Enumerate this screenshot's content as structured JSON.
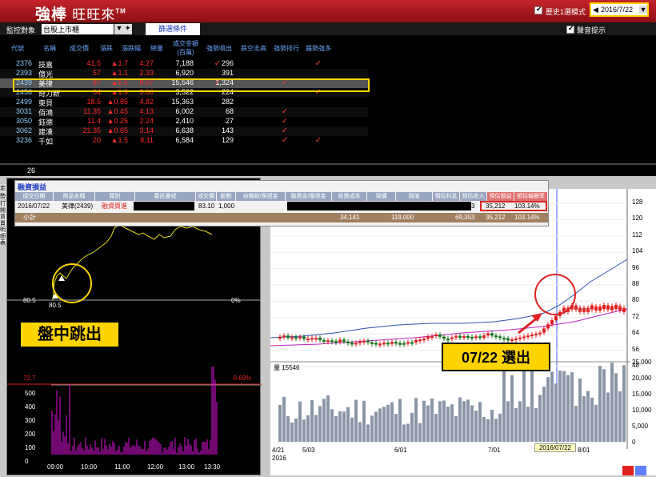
{
  "app": {
    "logo_main": "強棒",
    "logo_sub": "旺旺來",
    "logo_tm": "TM",
    "hist_label": "歷史1選模式",
    "date": "2016/7/22",
    "date_prev": "◀",
    "date_drop": "▼"
  },
  "toolbar": {
    "monitor_label": "監控對象",
    "monitor_value": "台股上市櫃",
    "monitor_btn": "▼ ✦",
    "filter_btn": "篩選條件",
    "sound_label": "聲音提示"
  },
  "table": {
    "headers": [
      "代號",
      "名稱",
      "成交價",
      "漲跌",
      "漲跌幅",
      "總量",
      "成交金額(百萬)",
      "強勢噴出",
      "跌空走高",
      "強勢排行",
      "趨勢強多"
    ],
    "rows": [
      {
        "code": "2376",
        "name": "技嘉",
        "price": "41.5",
        "chg": "▲1.7",
        "pct": "4.27",
        "vol": "7,188",
        "amt": "296",
        "checks": [
          1,
          0,
          0,
          1
        ]
      },
      {
        "code": "2393",
        "name": "億光",
        "price": "57",
        "chg": "▲1.1",
        "pct": "2.33",
        "vol": "6,920",
        "amt": "391",
        "checks": [
          0,
          0,
          0,
          0
        ]
      },
      {
        "code": "2439",
        "name": "美律",
        "price": "87",
        "chg": "▲6.5",
        "pct": "8.07",
        "vol": "15,546",
        "amt": "1,324",
        "checks": [
          1,
          0,
          1,
          0
        ]
      },
      {
        "code": "2456",
        "name": "奇力新",
        "price": "64",
        "chg": "▲1.9",
        "pct": "3.06",
        "vol": "3,522",
        "amt": "224",
        "checks": [
          0,
          0,
          0,
          1
        ]
      },
      {
        "code": "2499",
        "name": "東貝",
        "price": "18.5",
        "chg": "▲0.85",
        "pct": "4.82",
        "vol": "15,363",
        "amt": "282",
        "checks": [
          0,
          0,
          0,
          0
        ]
      },
      {
        "code": "3031",
        "name": "佰鴻",
        "price": "11.35",
        "chg": "▲0.45",
        "pct": "4.13",
        "vol": "6,002",
        "amt": "68",
        "checks": [
          0,
          0,
          1,
          0
        ]
      },
      {
        "code": "3050",
        "name": "鈺德",
        "price": "11.4",
        "chg": "▲0.25",
        "pct": "2.24",
        "vol": "2,410",
        "amt": "27",
        "checks": [
          0,
          0,
          1,
          0
        ]
      },
      {
        "code": "3062",
        "name": "建漢",
        "price": "21.35",
        "chg": "▲0.65",
        "pct": "3.14",
        "vol": "6,638",
        "amt": "143",
        "checks": [
          0,
          0,
          1,
          0
        ]
      },
      {
        "code": "3236",
        "name": "千如",
        "price": "20",
        "chg": "▲1.5",
        "pct": "8.11",
        "vol": "6,584",
        "amt": "129",
        "checks": [
          0,
          0,
          1,
          1
        ]
      }
    ],
    "count": "26"
  },
  "popup": {
    "title": "融資損益",
    "headers": [
      "成交日期",
      "商品名稱",
      "類別",
      "委託書號",
      "成交價",
      "股數",
      "自備款/保證金",
      "融資金/擔保金",
      "投資成本",
      "現價",
      "現值",
      "預估利息",
      "預估收入",
      "預估損益",
      "預估報酬率"
    ],
    "row": {
      "date": "2016/07/22",
      "name": "美律(2439)",
      "type": "融資買進",
      "price": "83.10",
      "shares": "1,000",
      "income": "69,353",
      "pl": "35,212",
      "ret": "103.14%"
    },
    "sub": {
      "label": "小計",
      "cost": "34,141",
      "value": "119,000",
      "income": "69,353",
      "pl": "35,212",
      "ret": "103.14%"
    }
  },
  "intraday": {
    "left_tabs": "走勢",
    "side_text": "打開買賣明細表",
    "ref_price": "80.5",
    "ref_pct": "0%",
    "low_price": "72.7",
    "low_pct": "-9.69%",
    "callout": "盤中跳出",
    "vol_ticks": [
      "500",
      "400",
      "300",
      "200",
      "100",
      "0"
    ],
    "time_ticks": [
      "09:00",
      "10:00",
      "11:00",
      "12:00",
      "13:00",
      "13:30"
    ]
  },
  "daily": {
    "price_ticks": [
      "128",
      "120",
      "112",
      "104",
      "96",
      "88",
      "80",
      "72",
      "64",
      "56",
      "48"
    ],
    "vol_label": "量 15546",
    "vol_ticks": [
      "25,000",
      "20,000",
      "15,000",
      "10,000",
      "5,000",
      "0"
    ],
    "date_ticks": [
      "4/21",
      "2016",
      "5/03",
      "6/01",
      "7/01",
      "8/01"
    ],
    "cursor_date": "2016/07/22",
    "callout": "07/22 選出"
  },
  "colors": {
    "title_red": "#b01a20",
    "highlight": "#ffd400",
    "up": "#ff2a2a"
  }
}
